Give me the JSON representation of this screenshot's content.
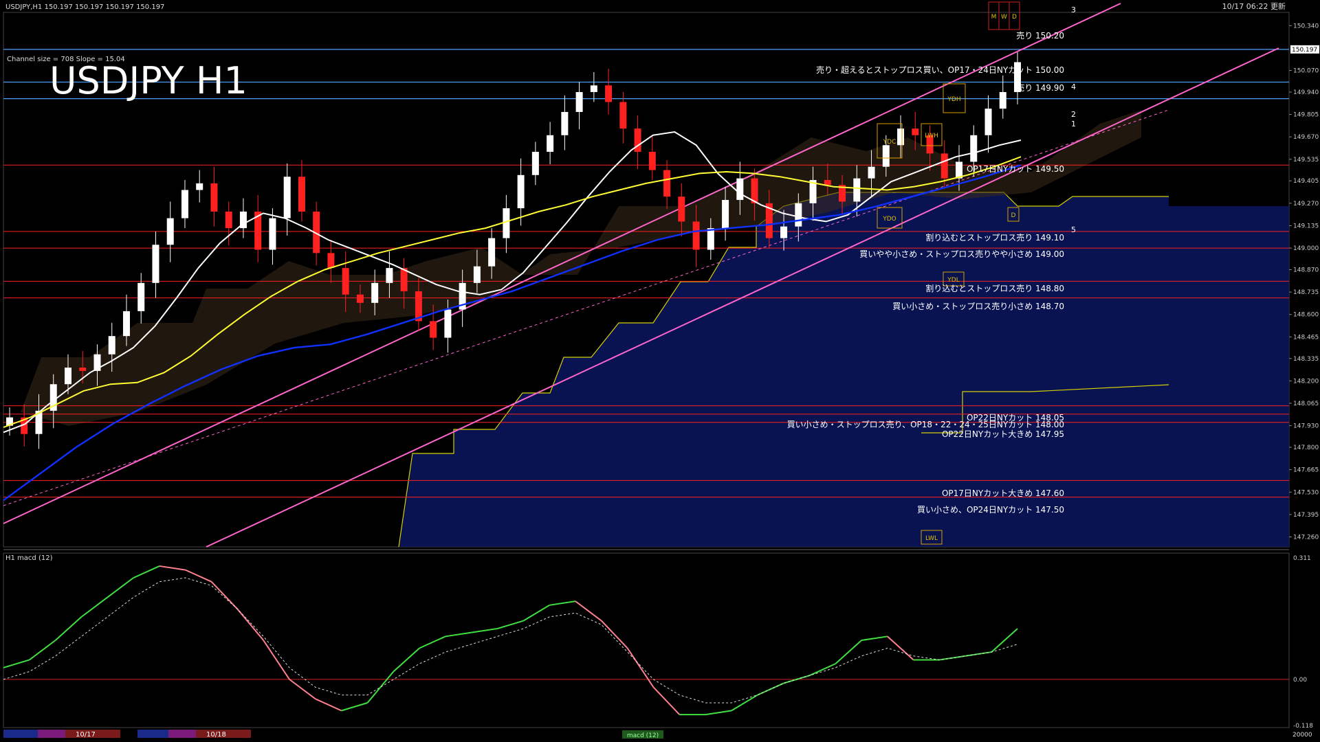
{
  "window": {
    "header": "USDJPY,H1  150.197 150.197 150.197 150.197",
    "server_time": "10/17 06:22 更新",
    "channel_info": "Channel size = 708 Slope = 15.04",
    "big_title": "USDJPY H1",
    "sub_window_label": "H1  macd (12)"
  },
  "price_axis": {
    "ticks": [
      "150.340",
      "150.070",
      "149.940",
      "149.805",
      "149.670",
      "149.535",
      "149.405",
      "149.270",
      "149.135",
      "149.000",
      "148.870",
      "148.735",
      "148.600",
      "148.465",
      "148.335",
      "148.200",
      "148.065",
      "147.930",
      "147.800",
      "147.665",
      "147.530",
      "147.395",
      "147.260"
    ],
    "current_price": "150.197"
  },
  "macd_axis": {
    "ticks": [
      "0.311",
      "0.00",
      "-0.118"
    ]
  },
  "bottom_bar": {
    "labels": [
      "10/17",
      "10/18"
    ],
    "indicator_tag": "macd (12)",
    "right_value": "20000"
  },
  "annotations": [
    {
      "text": "売り 150.20",
      "color": "#ffffff"
    },
    {
      "text": "売り・超えるとストップロス買い、OP17・24日NYカット 150.00",
      "color": "#ffffff"
    },
    {
      "text": "売り 149.90",
      "color": "#ffffff"
    },
    {
      "text": "OP17日NYカット 149.50",
      "color": "#ffffff"
    },
    {
      "text": "割り込むとストップロス売り 149.10",
      "color": "#ffffff"
    },
    {
      "text": "買いやや小さめ・ストップロス売りやや小さめ 149.00",
      "color": "#ffffff"
    },
    {
      "text": "割り込むとストップロス売り 148.80",
      "color": "#ffffff"
    },
    {
      "text": "買い小さめ・ストップロス売り小さめ 148.70",
      "color": "#ffffff"
    },
    {
      "text": "OP22日NYカット 148.05",
      "color": "#ffffff"
    },
    {
      "text": "買い小さめ・ストップロス売り、OP18・22・24・25日NYカット 148.00",
      "color": "#ffffff"
    },
    {
      "text": "OP22日NYカット大きめ 147.95",
      "color": "#ffffff"
    },
    {
      "text": "OP17日NYカット大きめ 147.60",
      "color": "#ffffff"
    },
    {
      "text": "買い小さめ、OP24日NYカット 147.50",
      "color": "#ffffff"
    }
  ],
  "boxes": [
    "YDH",
    "YDC",
    "LWH",
    "YDO",
    "YDL",
    "LWL",
    "D",
    "M",
    "W",
    "D"
  ],
  "projection_labels": [
    "3",
    "4",
    "2",
    "1",
    "5"
  ],
  "colors": {
    "up_candle": "#ffffff",
    "down_candle": "#ff2020",
    "grid_line": "#ff2020",
    "blue_line": "#4aa0ff",
    "channel": "#ff66cc",
    "ma_white": "#ffffff",
    "ma_yellow": "#ffff33",
    "ma_blue": "#1030ff",
    "chikou": "#20c020",
    "macd_up": "#40e040",
    "macd_down": "#ff8090"
  },
  "chart_data": {
    "type": "line",
    "symbol": "USDJPY",
    "timeframe": "H1",
    "ylim": [
      147.2,
      150.42
    ],
    "xlabel": "",
    "ylabel": "",
    "dates_visible": [
      "10/17",
      "10/18"
    ],
    "series": [
      {
        "name": "",
        "values": [
          147.98,
          147.88,
          148.02,
          148.18,
          148.28,
          148.26,
          148.36,
          148.47,
          148.62,
          148.79,
          149.02,
          149.18,
          149.35,
          149.39,
          149.22,
          149.12,
          149.22,
          148.99,
          149.18,
          149.43,
          149.22,
          148.97,
          148.88,
          148.72,
          148.67,
          148.79,
          148.88,
          148.74,
          148.56,
          148.46,
          148.63,
          148.79,
          148.89,
          149.06,
          149.24,
          149.44,
          149.58,
          149.68,
          149.82,
          149.94,
          149.98,
          149.88,
          149.72,
          149.58,
          149.47,
          149.31,
          149.16,
          148.99,
          149.12,
          149.29,
          149.42,
          149.27,
          149.06,
          149.13,
          149.27,
          149.41,
          149.38,
          149.28,
          149.42,
          149.49,
          149.62,
          149.72,
          149.68,
          149.57,
          149.42,
          149.52,
          149.68,
          149.84,
          149.94,
          150.12
        ]
      },
      {
        "name": "",
        "values": [
          147.89,
          147.94,
          148.05,
          148.15,
          148.25,
          148.32,
          148.4,
          148.53,
          148.7,
          148.88,
          149.03,
          149.14,
          149.21,
          149.18,
          149.12,
          149.05,
          149.0,
          148.95,
          148.9,
          148.84,
          148.78,
          148.74,
          148.72,
          148.75,
          148.85,
          149.0,
          149.15,
          149.31,
          149.46,
          149.59,
          149.68,
          149.7,
          149.62,
          149.45,
          149.33,
          149.26,
          149.21,
          149.18,
          149.16,
          149.2,
          149.3,
          149.4,
          149.45,
          149.5,
          149.55,
          149.58,
          149.62,
          149.65
        ]
      },
      {
        "name": "",
        "values": [
          147.92,
          147.98,
          148.06,
          148.14,
          148.18,
          148.19,
          148.25,
          148.35,
          148.48,
          148.6,
          148.71,
          148.8,
          148.87,
          148.92,
          148.97,
          149.01,
          149.05,
          149.09,
          149.12,
          149.17,
          149.22,
          149.26,
          149.31,
          149.35,
          149.39,
          149.42,
          149.45,
          149.46,
          149.45,
          149.43,
          149.4,
          149.37,
          149.36,
          149.35,
          149.37,
          149.4,
          149.44,
          149.49,
          149.55
        ]
      },
      {
        "name": "",
        "values": [
          147.48,
          147.64,
          147.8,
          147.94,
          148.06,
          148.17,
          148.27,
          148.35,
          148.4,
          148.42,
          148.48,
          148.55,
          148.62,
          148.68,
          148.74,
          148.82,
          148.9,
          148.98,
          149.05,
          149.1,
          149.12,
          149.14,
          149.17,
          149.2,
          149.25,
          149.31,
          149.37,
          149.43,
          149.5
        ]
      },
      {
        "name": "",
        "values": [
          0.03,
          0.05,
          0.1,
          0.16,
          0.21,
          0.26,
          0.29,
          0.28,
          0.25,
          0.18,
          0.1,
          0.0,
          -0.05,
          -0.08,
          -0.06,
          0.02,
          0.08,
          0.11,
          0.12,
          0.13,
          0.15,
          0.19,
          0.2,
          0.15,
          0.08,
          -0.02,
          -0.09,
          -0.09,
          -0.08,
          -0.04,
          -0.01,
          0.01,
          0.04,
          0.1,
          0.11,
          0.05,
          0.05,
          0.06,
          0.07,
          0.13
        ]
      },
      {
        "name": "",
        "values": [
          0.0,
          0.02,
          0.06,
          0.11,
          0.16,
          0.21,
          0.25,
          0.26,
          0.24,
          0.18,
          0.11,
          0.03,
          -0.02,
          -0.04,
          -0.04,
          0.0,
          0.04,
          0.07,
          0.09,
          0.11,
          0.13,
          0.16,
          0.17,
          0.14,
          0.07,
          0.0,
          -0.04,
          -0.06,
          -0.06,
          -0.04,
          -0.01,
          0.01,
          0.03,
          0.06,
          0.08,
          0.06,
          0.05,
          0.06,
          0.07,
          0.09
        ]
      }
    ]
  }
}
